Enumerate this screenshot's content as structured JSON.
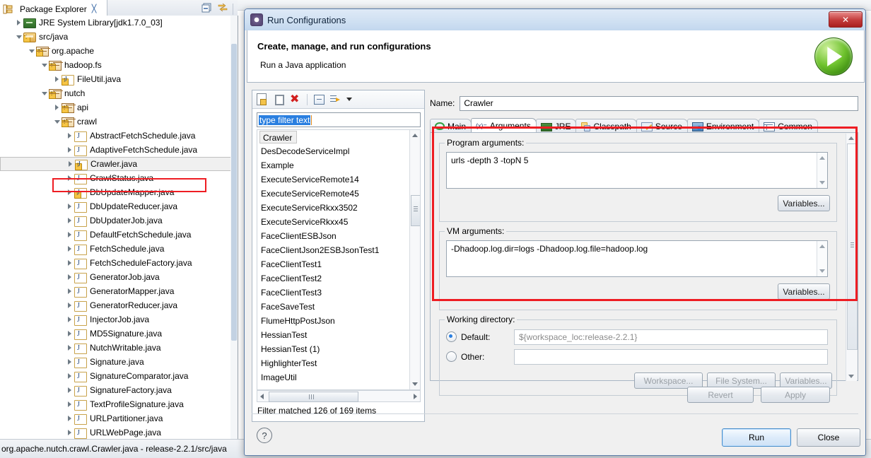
{
  "ide": {
    "package_explorer": {
      "tab_label": "Package Explorer",
      "close_glyph": "╳",
      "toolbar": [
        {
          "name": "collapse-all-icon"
        },
        {
          "name": "link-with-editor-icon"
        }
      ],
      "tree": [
        {
          "label": "JRE System Library",
          "suffix": " [jdk1.7.0_03]",
          "indent": 1,
          "arrow": "closed",
          "icon": "library-icon",
          "warn": false,
          "selected": false
        },
        {
          "label": "src/java",
          "suffix": "",
          "indent": 1,
          "arrow": "open",
          "icon": "source-folder-icon",
          "warn": true,
          "selected": false
        },
        {
          "label": "org.apache",
          "suffix": "",
          "indent": 2,
          "arrow": "open",
          "icon": "package-icon",
          "warn": true,
          "selected": false
        },
        {
          "label": "hadoop.fs",
          "suffix": "",
          "indent": 3,
          "arrow": "open",
          "icon": "package-icon",
          "warn": true,
          "selected": false
        },
        {
          "label": "FileUtil.java",
          "suffix": "",
          "indent": 4,
          "arrow": "closed",
          "icon": "java-file-icon",
          "warn": true,
          "selected": false
        },
        {
          "label": "nutch",
          "suffix": "",
          "indent": 3,
          "arrow": "open",
          "icon": "package-icon",
          "warn": true,
          "selected": false
        },
        {
          "label": "api",
          "suffix": "",
          "indent": 4,
          "arrow": "closed",
          "icon": "package-icon",
          "warn": true,
          "selected": false
        },
        {
          "label": "crawl",
          "suffix": "",
          "indent": 4,
          "arrow": "open",
          "icon": "package-icon",
          "warn": true,
          "selected": false
        },
        {
          "label": "AbstractFetchSchedule.java",
          "suffix": "",
          "indent": 5,
          "arrow": "closed",
          "icon": "java-file-icon",
          "warn": false,
          "selected": false
        },
        {
          "label": "AdaptiveFetchSchedule.java",
          "suffix": "",
          "indent": 5,
          "arrow": "closed",
          "icon": "java-file-icon",
          "warn": false,
          "selected": false
        },
        {
          "label": "Crawler.java",
          "suffix": "",
          "indent": 5,
          "arrow": "closed",
          "icon": "java-file-icon",
          "warn": true,
          "selected": true
        },
        {
          "label": "CrawlStatus.java",
          "suffix": "",
          "indent": 5,
          "arrow": "closed",
          "icon": "java-file-icon",
          "warn": false,
          "selected": false
        },
        {
          "label": "DbUpdateMapper.java",
          "suffix": "",
          "indent": 5,
          "arrow": "closed",
          "icon": "java-file-icon",
          "warn": true,
          "selected": false
        },
        {
          "label": "DbUpdateReducer.java",
          "suffix": "",
          "indent": 5,
          "arrow": "closed",
          "icon": "java-file-icon",
          "warn": false,
          "selected": false
        },
        {
          "label": "DbUpdaterJob.java",
          "suffix": "",
          "indent": 5,
          "arrow": "closed",
          "icon": "java-file-icon",
          "warn": false,
          "selected": false
        },
        {
          "label": "DefaultFetchSchedule.java",
          "suffix": "",
          "indent": 5,
          "arrow": "closed",
          "icon": "java-file-icon",
          "warn": false,
          "selected": false
        },
        {
          "label": "FetchSchedule.java",
          "suffix": "",
          "indent": 5,
          "arrow": "closed",
          "icon": "java-file-icon",
          "warn": false,
          "selected": false
        },
        {
          "label": "FetchScheduleFactory.java",
          "suffix": "",
          "indent": 5,
          "arrow": "closed",
          "icon": "java-file-icon",
          "warn": false,
          "selected": false
        },
        {
          "label": "GeneratorJob.java",
          "suffix": "",
          "indent": 5,
          "arrow": "closed",
          "icon": "java-file-icon",
          "warn": false,
          "selected": false
        },
        {
          "label": "GeneratorMapper.java",
          "suffix": "",
          "indent": 5,
          "arrow": "closed",
          "icon": "java-file-icon",
          "warn": false,
          "selected": false
        },
        {
          "label": "GeneratorReducer.java",
          "suffix": "",
          "indent": 5,
          "arrow": "closed",
          "icon": "java-file-icon",
          "warn": false,
          "selected": false
        },
        {
          "label": "InjectorJob.java",
          "suffix": "",
          "indent": 5,
          "arrow": "closed",
          "icon": "java-file-icon",
          "warn": false,
          "selected": false
        },
        {
          "label": "MD5Signature.java",
          "suffix": "",
          "indent": 5,
          "arrow": "closed",
          "icon": "java-file-icon",
          "warn": false,
          "selected": false
        },
        {
          "label": "NutchWritable.java",
          "suffix": "",
          "indent": 5,
          "arrow": "closed",
          "icon": "java-file-icon",
          "warn": false,
          "selected": false
        },
        {
          "label": "Signature.java",
          "suffix": "",
          "indent": 5,
          "arrow": "closed",
          "icon": "java-file-icon",
          "warn": false,
          "selected": false
        },
        {
          "label": "SignatureComparator.java",
          "suffix": "",
          "indent": 5,
          "arrow": "closed",
          "icon": "java-file-icon",
          "warn": false,
          "selected": false
        },
        {
          "label": "SignatureFactory.java",
          "suffix": "",
          "indent": 5,
          "arrow": "closed",
          "icon": "java-file-icon",
          "warn": false,
          "selected": false
        },
        {
          "label": "TextProfileSignature.java",
          "suffix": "",
          "indent": 5,
          "arrow": "closed",
          "icon": "java-file-icon",
          "warn": false,
          "selected": false
        },
        {
          "label": "URLPartitioner.java",
          "suffix": "",
          "indent": 5,
          "arrow": "closed",
          "icon": "java-file-icon",
          "warn": false,
          "selected": false
        },
        {
          "label": "URLWebPage.java",
          "suffix": "",
          "indent": 5,
          "arrow": "closed",
          "icon": "java-file-icon",
          "warn": false,
          "selected": false
        }
      ]
    },
    "statusbar": {
      "text": "org.apache.nutch.crawl.Crawler.java - release-2.2.1/src/java"
    }
  },
  "dialog": {
    "title": "Run Configurations",
    "title_icon": "gear-icon",
    "close_label": "✕",
    "heading": "Create, manage, and run configurations",
    "subheading": "Run a Java application",
    "run_badge_icon": "run-play-icon",
    "toolbar": [
      {
        "name": "new-configuration-icon"
      },
      {
        "name": "duplicate-configuration-icon"
      },
      {
        "name": "delete-configuration-icon"
      },
      {
        "name": "collapse-all-icon"
      },
      {
        "name": "filter-icon"
      },
      {
        "name": "chevron-down-icon"
      }
    ],
    "filter": {
      "value": "type filter text",
      "placeholder": "type filter text"
    },
    "config_list": [
      "Crawler",
      "DesDecodeServiceImpl",
      "Example",
      "ExecuteServiceRemote14",
      "ExecuteServiceRemote45",
      "ExecuteServiceRkxx3502",
      "ExecuteServiceRkxx45",
      "FaceClientESBJson",
      "FaceClientJson2ESBJsonTest1",
      "FaceClientTest1",
      "FaceClientTest2",
      "FaceClientTest3",
      "FaceSaveTest",
      "FlumeHttpPostJson",
      "HessianTest",
      "HessianTest (1)",
      "HighlighterTest",
      "ImageUtil"
    ],
    "selected_config": "Crawler",
    "filter_status": "Filter matched 126 of 169 items",
    "name": {
      "label": "Name:",
      "value": "Crawler"
    },
    "tabs": [
      {
        "label": "Main",
        "icon": "main-icon",
        "active": false
      },
      {
        "label": "Arguments",
        "icon": "arguments-icon",
        "active": true
      },
      {
        "label": "JRE",
        "icon": "jre-icon",
        "active": false
      },
      {
        "label": "Classpath",
        "icon": "classpath-icon",
        "active": false
      },
      {
        "label": "Source",
        "icon": "source-icon",
        "active": false
      },
      {
        "label": "Environment",
        "icon": "environment-icon",
        "active": false
      },
      {
        "label": "Common",
        "icon": "common-icon",
        "active": false
      }
    ],
    "arguments": {
      "program_args_label": "Program arguments:",
      "program_args_value": "urls -depth 3 -topN 5",
      "program_variables_label": "Variables...",
      "vm_args_label": "VM arguments:",
      "vm_args_value": "-Dhadoop.log.dir=logs -Dhadoop.log.file=hadoop.log",
      "vm_variables_label": "Variables..."
    },
    "working_directory": {
      "group_label": "Working directory:",
      "default_label": "Default:",
      "default_value": "${workspace_loc:release-2.2.1}",
      "default_selected": true,
      "other_label": "Other:",
      "other_value": "",
      "workspace_label": "Workspace...",
      "file_system_label": "File System...",
      "variables_label": "Variables..."
    },
    "footer": {
      "revert_label": "Revert",
      "apply_label": "Apply",
      "help_label": "?",
      "run_label": "Run",
      "close_label": "Close"
    },
    "annotation_color": "#ee1d23"
  }
}
